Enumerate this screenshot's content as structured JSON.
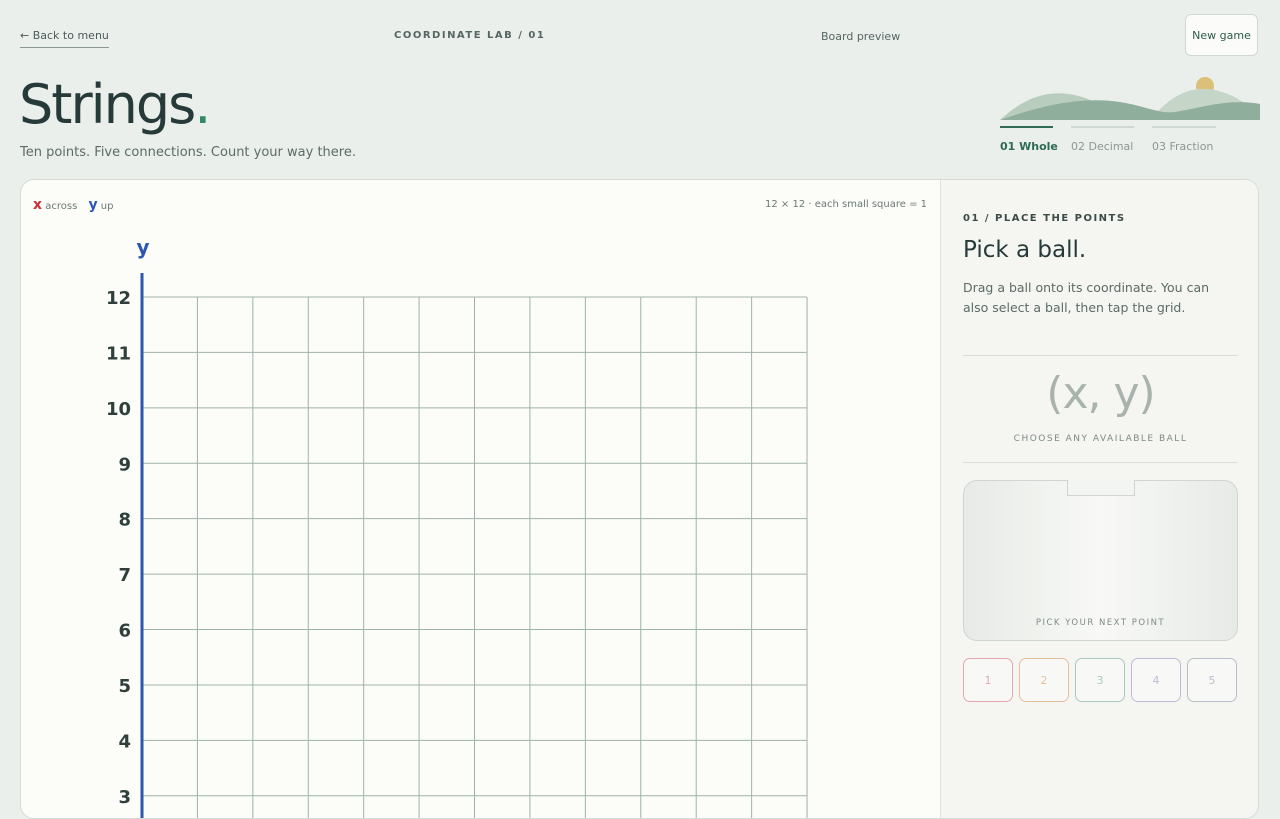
{
  "header": {
    "back_label": "← Back to menu",
    "crumb": "COORDINATE LAB / 01",
    "board_preview": "Board preview",
    "new_game": "New game"
  },
  "hero": {
    "title": "Strings",
    "title_dot": ".",
    "subtitle": "Ten points. Five connections. Count your way there."
  },
  "tabs": [
    {
      "label": "01 Whole",
      "active": true
    },
    {
      "label": "02 Decimal",
      "active": false
    },
    {
      "label": "03 Fraction",
      "active": false
    }
  ],
  "board": {
    "legend_x": "x",
    "legend_x_text": "across",
    "legend_y": "y",
    "legend_y_text": "up",
    "scale_note": "12 × 12 · each small square = 1",
    "y_axis_label": "y",
    "y_ticks_visible": [
      12,
      11,
      10,
      9,
      8,
      7,
      6,
      5,
      4,
      3
    ],
    "grid_size": 12
  },
  "panel": {
    "step_label": "01 / PLACE THE POINTS",
    "title": "Pick a ball.",
    "description": "Drag a ball onto its coordinate. You can also select a ball, then tap the grid.",
    "coord_display": "(x, y)",
    "coord_hint": "CHOOSE ANY AVAILABLE BALL",
    "tray_label": "PICK YOUR NEXT POINT",
    "balls": [
      {
        "label": "1",
        "color": "#e3a7ad"
      },
      {
        "label": "2",
        "color": "#e6c19c"
      },
      {
        "label": "3",
        "color": "#a9cbbf"
      },
      {
        "label": "4",
        "color": "#c1badb"
      },
      {
        "label": "5",
        "color": "#b9c0cc"
      }
    ]
  },
  "colors": {
    "x_axis": "#c9303a",
    "y_axis": "#2b57b3",
    "grid": "#9fb2ab",
    "accent": "#2f6b57"
  }
}
